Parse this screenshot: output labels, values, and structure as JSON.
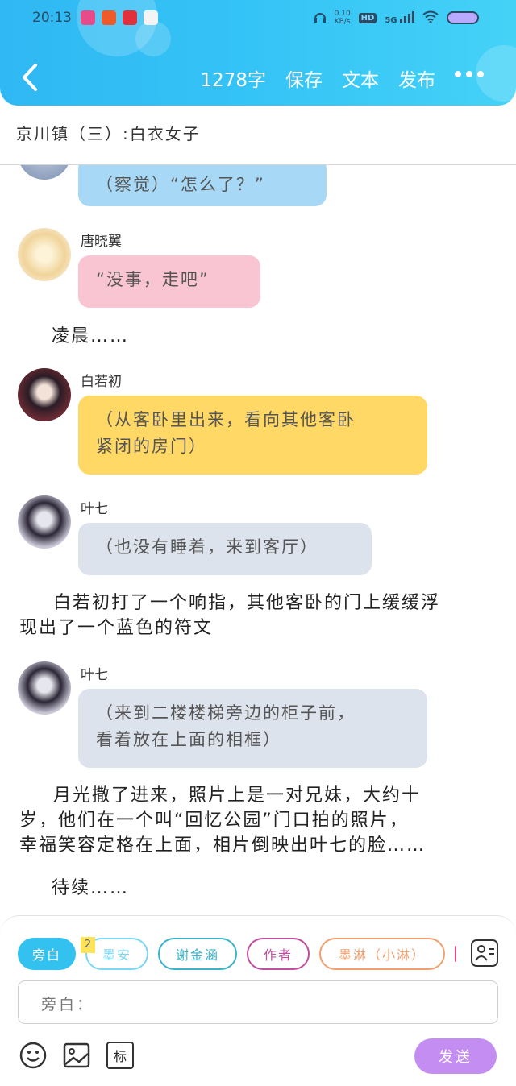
{
  "status_bar": {
    "time": "20:13",
    "speed": "0.10",
    "speed_unit": "KB/s",
    "hd": "HD",
    "network": "5G"
  },
  "header": {
    "word_count": "1278字",
    "save_label": "保存",
    "text_label": "文本",
    "publish_label": "发布",
    "back_icon": "back-chevron",
    "more_icon": "more-dots"
  },
  "chapter": {
    "title": "京川镇（三）:白衣女子"
  },
  "messages": [
    {
      "speaker": "",
      "text": "（察觉）“怎么了？”",
      "bubble_color": "#a7d9f7"
    },
    {
      "speaker": "唐晓翼",
      "text": "“没事，走吧”",
      "bubble_color": "#f9c5d3"
    },
    {
      "narration": "凌晨……"
    },
    {
      "speaker": "白若初",
      "text": "（从客卧里出来，看向其他客卧紧闭的房门）",
      "bubble_color": "#ffd866"
    },
    {
      "speaker": "叶七",
      "text": "（也没有睡着，来到客厅）",
      "bubble_color": "#dde3ec"
    },
    {
      "narration": "白若初打了一个响指，其他客卧的门上缓缓浮现出了一个蓝色的符文"
    },
    {
      "speaker": "叶七",
      "text": "（来到二楼楼梯旁边的柜子前，看着放在上面的相框）",
      "bubble_color": "#dde3ec"
    },
    {
      "narration": "月光撒了进来，照片上是一对兄妹，大约十岁，他们在一个叫“回忆公园”门口拍的照片，幸福笑容定格在上面，相片倒映出叶七的脸……"
    },
    {
      "narration": "待续……"
    }
  ],
  "narrations": {
    "n1": "凌晨……",
    "n2_line1": "白若初打了一个响指，其他客卧的门上缓缓浮",
    "n2_line2": "现出了一个蓝色的符文",
    "n3_line1": "月光撒了进来，照片上是一对兄妹，大约十",
    "n3_line2": "岁，他们在一个叫“回忆公园”门口拍的照片，",
    "n3_line3": "幸福笑容定格在上面，相片倒映出叶七的脸……",
    "n4": "待续……"
  },
  "bubbles": {
    "b1": "（察觉）“怎么了？”",
    "b2": "“没事，走吧”",
    "b3_line1": "（从客卧里出来，看向其他客卧",
    "b3_line2": "紧闭的房门）",
    "b4": "（也没有睡着，来到客厅）",
    "b5_line1": "（来到二楼楼梯旁边的柜子前，",
    "b5_line2": "看着放在上面的相框）"
  },
  "speakers": {
    "s2": "唐晓翼",
    "s3": "白若初",
    "s4": "叶七",
    "s5": "叶七"
  },
  "composer": {
    "chips": [
      {
        "label": "旁白",
        "selected": true,
        "color": "#33c2f0"
      },
      {
        "label": "墨安",
        "selected": false,
        "color": "#7ad7f5"
      },
      {
        "label": "谢金涵",
        "selected": false,
        "color": "#3bb3c9"
      },
      {
        "label": "作者",
        "selected": false,
        "color": "#c04fa0"
      },
      {
        "label": "墨淋（小淋）",
        "selected": false,
        "color": "#f0a070"
      }
    ],
    "badge": "2",
    "input_placeholder": "旁白：",
    "send_label": "发送",
    "tool_icons": [
      "emoji-icon",
      "image-icon",
      "mark-icon"
    ],
    "mark_label": "标"
  }
}
